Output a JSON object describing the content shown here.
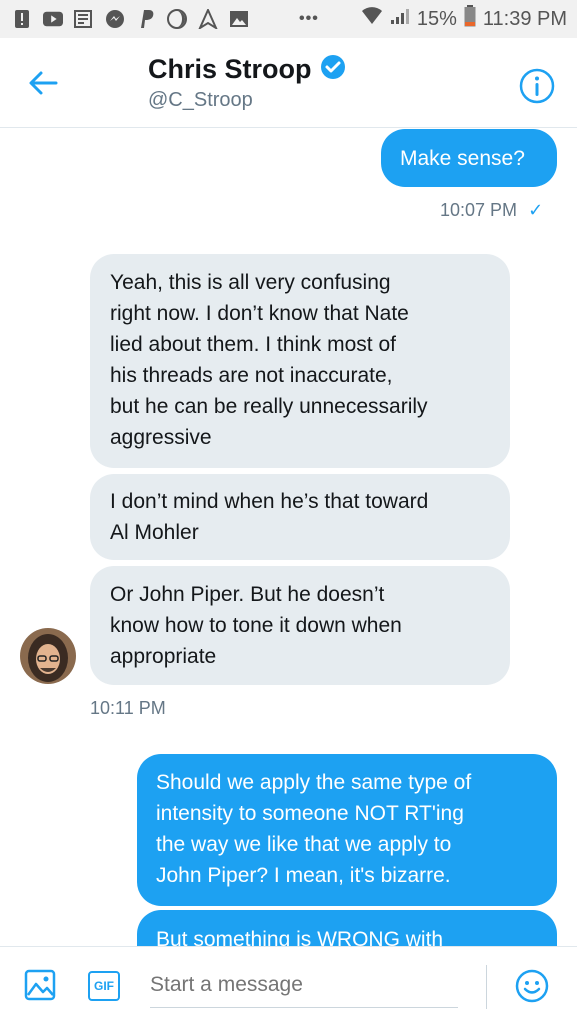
{
  "status_bar": {
    "battery_percent": "15%",
    "time": "11:39 PM",
    "overflow": "•••",
    "notification_icons": [
      "alert-icon",
      "youtube-icon",
      "news-icon",
      "messenger-icon",
      "paypal-icon",
      "moon-icon",
      "direction-icon",
      "image-icon"
    ]
  },
  "header": {
    "name": "Chris Stroop",
    "handle": "@C_Stroop",
    "verified": true,
    "accent_color": "#1da1f2"
  },
  "messages": [
    {
      "direction": "out",
      "text": "Make sense?"
    },
    {
      "direction": "out_meta",
      "text": "10:07 PM",
      "status": "✓"
    },
    {
      "direction": "in",
      "lines": [
        "Yeah, this is all very confusing",
        "right now. I don’t know that Nate",
        "lied about them. I think most of",
        "his threads are not inaccurate,",
        "but he can be really unnecessarily",
        "aggressive"
      ]
    },
    {
      "direction": "in",
      "lines": [
        "I don’t mind when he’s that toward",
        "Al Mohler"
      ]
    },
    {
      "direction": "in",
      "lines": [
        "Or John Piper. But he doesn’t",
        "know how to tone it down when",
        "appropriate"
      ]
    },
    {
      "direction": "in_meta",
      "text": "10:11 PM"
    },
    {
      "direction": "out",
      "lines": [
        "Should we apply the same type of",
        "intensity to someone NOT RT'ing",
        "the way we like that we apply to",
        "John Piper? I mean, it's bizarre."
      ]
    },
    {
      "direction": "out",
      "lines": [
        "But something is WRONG with"
      ]
    }
  ],
  "compose": {
    "placeholder": "Start a message",
    "gif_label": "GIF"
  }
}
